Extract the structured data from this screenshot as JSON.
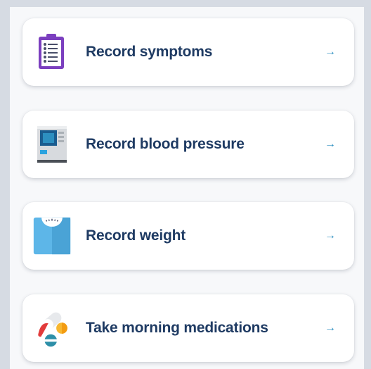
{
  "tasks": [
    {
      "label": "Record symptoms",
      "icon": "clipboard-icon",
      "arrow": "→"
    },
    {
      "label": "Record blood pressure",
      "icon": "blood-pressure-monitor-icon",
      "arrow": "→"
    },
    {
      "label": "Record weight",
      "icon": "weight-scale-icon",
      "arrow": "→"
    },
    {
      "label": "Take morning medications",
      "icon": "pills-icon",
      "arrow": "→"
    }
  ],
  "colors": {
    "label": "#1f3b63",
    "arrow": "#2d8fc0",
    "card": "#ffffff",
    "background": "#f7f8fa"
  }
}
